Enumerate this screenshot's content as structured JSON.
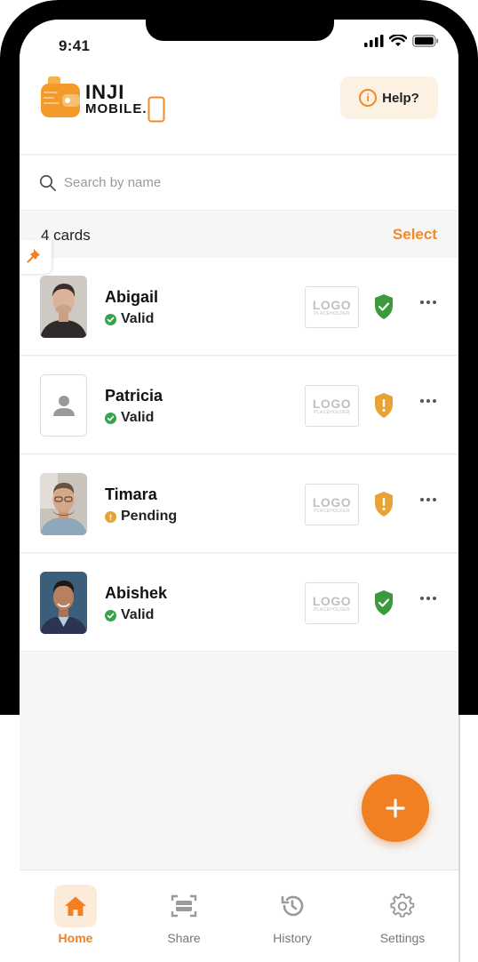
{
  "status_bar": {
    "time": "9:41"
  },
  "header": {
    "logo_line1": "INJI",
    "logo_line2": "MOBILE.",
    "help_label": "Help?",
    "help_icon": "info-icon"
  },
  "search": {
    "placeholder": "Search by name"
  },
  "list": {
    "count_label": "4 cards",
    "select_label": "Select"
  },
  "cards": [
    {
      "name": "Abigail",
      "status": "Valid",
      "logo_text": "LOGO",
      "logo_sub": "PLACEHOLDER",
      "verification": "verified",
      "pinned": true
    },
    {
      "name": "Patricia",
      "status": "Valid",
      "logo_text": "LOGO",
      "logo_sub": "PLACEHOLDER",
      "verification": "warning"
    },
    {
      "name": "Timara",
      "status": "Pending",
      "logo_text": "LOGO",
      "logo_sub": "PLACEHOLDER",
      "verification": "warning"
    },
    {
      "name": "Abishek",
      "status": "Valid",
      "logo_text": "LOGO",
      "logo_sub": "PLACEHOLDER",
      "verification": "verified"
    }
  ],
  "bottom_nav": [
    {
      "label": "Home",
      "icon": "home-icon",
      "active": true
    },
    {
      "label": "Share",
      "icon": "scan-icon",
      "active": false
    },
    {
      "label": "History",
      "icon": "history-icon",
      "active": false
    },
    {
      "label": "Settings",
      "icon": "gear-icon",
      "active": false
    }
  ],
  "colors": {
    "accent": "#f08021",
    "valid": "#3aa24a",
    "pending": "#e8a337",
    "shield_ok": "#3a9a3c",
    "shield_warn": "#e8a337"
  }
}
